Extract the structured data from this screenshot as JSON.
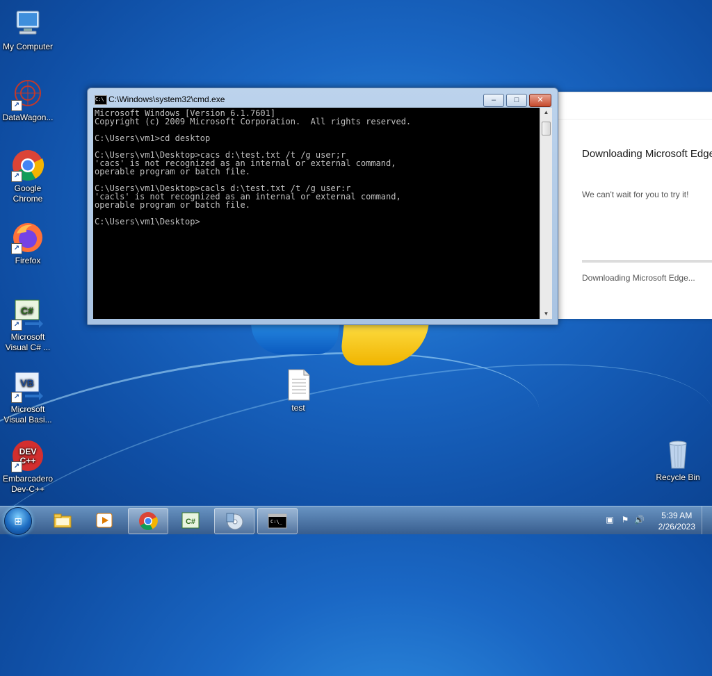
{
  "desktop": {
    "icons": [
      {
        "label": "My Computer"
      },
      {
        "label": "DataWagon..."
      },
      {
        "label": "Google Chrome"
      },
      {
        "label": "Firefox"
      },
      {
        "label": "Microsoft Visual C# ..."
      },
      {
        "label": "Microsoft Visual Basi..."
      },
      {
        "label": "Embarcadero Dev-C++"
      },
      {
        "label": "test"
      },
      {
        "label": "Recycle Bin"
      }
    ]
  },
  "cmd_window": {
    "title": "C:\\Windows\\system32\\cmd.exe",
    "icon_text": "C:\\",
    "buttons": {
      "minimize": "–",
      "maximize": "□",
      "close": "✕"
    },
    "output": "Microsoft Windows [Version 6.1.7601]\nCopyright (c) 2009 Microsoft Corporation.  All rights reserved.\n\nC:\\Users\\vm1>cd desktop\n\nC:\\Users\\vm1\\Desktop>cacs d:\\test.txt /t /g user;r\n'cacs' is not recognized as an internal or external command,\noperable program or batch file.\n\nC:\\Users\\vm1\\Desktop>cacls d:\\test.txt /t /g user:r\n'cacls' is not recognized as an internal or external command,\noperable program or batch file.\n\nC:\\Users\\vm1\\Desktop>"
  },
  "edge_dialog": {
    "title": "Downloading Microsoft Edge",
    "subtitle": "We can't wait for you to try it!",
    "status": "Downloading Microsoft Edge...",
    "progress": 0
  },
  "taskbar": {
    "items": [
      "windows-explorer",
      "media-player",
      "google-chrome",
      "visual-csharp",
      "setup",
      "command-prompt"
    ],
    "active_item": "command-prompt",
    "clock": {
      "time": "5:39 AM",
      "date": "2/26/2023"
    }
  },
  "colors": {
    "console_text": "#c0c0c0",
    "console_bg": "#000000",
    "accent": "#1a67c4"
  }
}
